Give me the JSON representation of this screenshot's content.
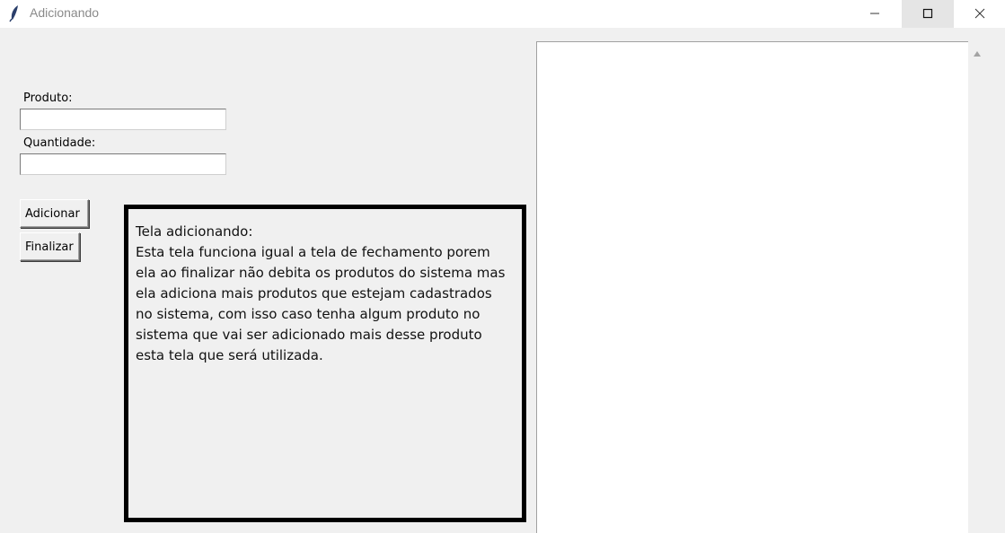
{
  "window": {
    "title": "Adicionando",
    "icon": "feather-icon"
  },
  "form": {
    "produto_label": "Produto:",
    "produto_value": "",
    "quantidade_label": "Quantidade:",
    "quantidade_value": ""
  },
  "buttons": {
    "adicionar_label": "Adicionar",
    "finalizar_label": "Finalizar"
  },
  "info": {
    "title": "Tela adicionando:",
    "body": "Esta tela funciona igual a tela de fechamento porem ela ao finalizar não debita os produtos do sistema mas ela adiciona mais produtos que estejam cadastrados no sistema, com isso caso tenha algum produto no sistema que vai ser adicionado mais desse produto esta tela que será utilizada."
  },
  "list": {
    "items": []
  }
}
